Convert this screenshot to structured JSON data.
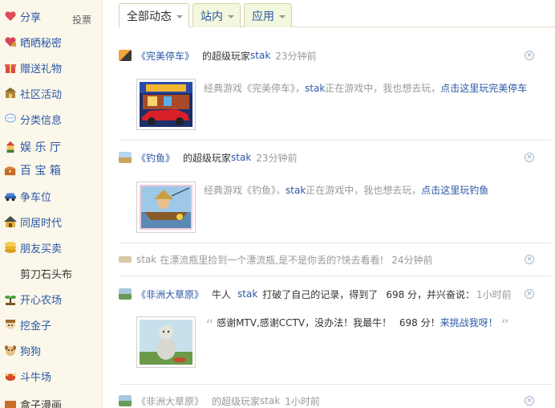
{
  "sidebar": {
    "vote_label": "投票",
    "items": [
      {
        "label": "分享",
        "icon": "heart-share-icon"
      },
      {
        "label": "晒晒秘密",
        "icon": "heart-secret-icon"
      },
      {
        "label": "赠送礼物",
        "icon": "gift-icon"
      },
      {
        "label": "社区活动",
        "icon": "community-icon"
      },
      {
        "label": "分类信息",
        "icon": "chat-bubble-icon"
      },
      {
        "label": "娱 乐 厅",
        "icon": "jester-icon"
      },
      {
        "label": "百 宝 箱",
        "icon": "treasure-box-icon"
      },
      {
        "label": "争车位",
        "icon": "car-icon"
      },
      {
        "label": "同居时代",
        "icon": "house-icon"
      },
      {
        "label": "朋友买卖",
        "icon": "coins-icon"
      },
      {
        "label": "剪刀石头布",
        "icon": "scissors-icon"
      },
      {
        "label": "开心农场",
        "icon": "sprout-icon"
      },
      {
        "label": "挖金子",
        "icon": "miner-icon"
      },
      {
        "label": "狗狗",
        "icon": "dog-icon"
      },
      {
        "label": "斗牛场",
        "icon": "bull-icon"
      },
      {
        "label": "盒子漫画",
        "icon": "comic-box-icon"
      }
    ]
  },
  "tabs": [
    {
      "label": "全部动态",
      "active": true
    },
    {
      "label": "站内",
      "active": false
    },
    {
      "label": "应用",
      "active": false
    }
  ],
  "feed": [
    {
      "game": "《完美停车》",
      "text": "的超级玩家",
      "user": "stak",
      "time": "23分钟前",
      "desc_prefix": "经典游戏《完美停车》，",
      "desc_user": "stak",
      "desc_mid": "正在游戏中，我也想去玩，",
      "desc_link": "点击这里玩完美停车"
    },
    {
      "game": "《钓鱼》",
      "text": "的超级玩家",
      "user": "stak",
      "time": "23分钟前",
      "desc_prefix": "经典游戏《钓鱼》，",
      "desc_user": "stak",
      "desc_mid": "正在游戏中，我也想去玩，",
      "desc_link": "点击这里玩钓鱼"
    },
    {
      "user": "stak",
      "text": "在漂流瓶里捡到一个漂流瓶,是不是你丢的?快去看看!",
      "time": "24分钟前"
    },
    {
      "game": "《非洲大草原》",
      "cow": "牛人",
      "user": "stak",
      "text1": "打破了自己的记录，得到了",
      "score": "698 分，并兴奋说：",
      "time": "1小时前",
      "quote_text": "感谢MTV,感谢CCTV，没办法！我最牛！",
      "quote_score": "698 分！",
      "quote_link": "来挑战我呀！"
    },
    {
      "game": "《非洲大草原》",
      "text": "的超级玩家",
      "user": "stak",
      "time": "1小时前"
    }
  ],
  "colors": {
    "link": "#2b57a6",
    "sidebar_bg": "#fbf7ea",
    "tab_bg": "#f3f7dd"
  }
}
